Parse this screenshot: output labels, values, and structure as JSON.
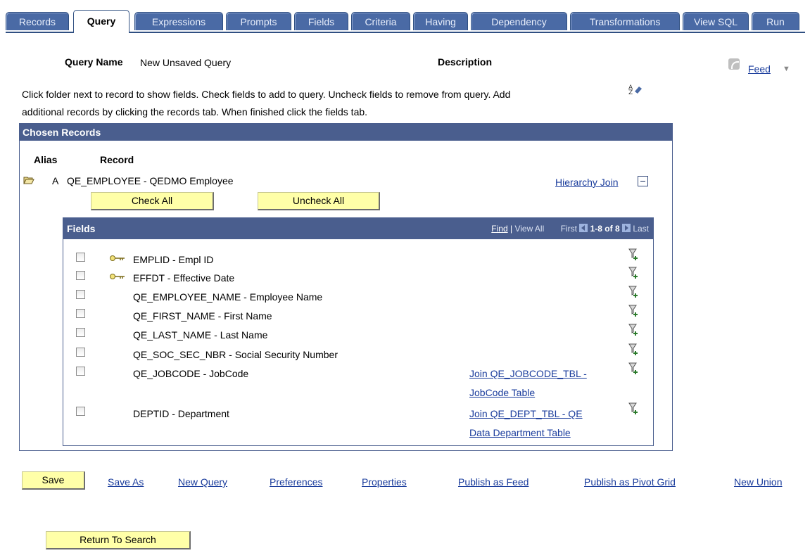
{
  "tabs": [
    "Records",
    "Query",
    "Expressions",
    "Prompts",
    "Fields",
    "Criteria",
    "Having",
    "Dependency",
    "Transformations",
    "View SQL",
    "Run"
  ],
  "header": {
    "query_name_label": "Query Name",
    "query_name_value": "New Unsaved Query",
    "description_label": "Description",
    "feed_label": "Feed",
    "instructions_line1": "Click folder next to record to show fields. Check fields to add to query. Uncheck fields to remove from query. Add",
    "instructions_line2": "additional records by clicking the records tab. When finished click the fields tab."
  },
  "chosen_records": {
    "title": "Chosen Records",
    "alias_header": "Alias",
    "record_header": "Record",
    "alias": "A",
    "record": "QE_EMPLOYEE - QEDMO Employee",
    "hierarchy_join": "Hierarchy Join",
    "check_all": "Check All",
    "uncheck_all": "Uncheck All"
  },
  "fields_grid": {
    "title": "Fields",
    "find": "Find",
    "view_all": "View All",
    "first": "First",
    "range": "1-8 of 8",
    "last": "Last",
    "rows": [
      {
        "label": "EMPLID - Empl ID",
        "key": true,
        "join1": "",
        "join2": ""
      },
      {
        "label": "EFFDT - Effective Date",
        "key": true,
        "join1": "",
        "join2": ""
      },
      {
        "label": "QE_EMPLOYEE_NAME - Employee Name",
        "key": false,
        "join1": "",
        "join2": ""
      },
      {
        "label": "QE_FIRST_NAME - First Name",
        "key": false,
        "join1": "",
        "join2": ""
      },
      {
        "label": "QE_LAST_NAME - Last Name",
        "key": false,
        "join1": "",
        "join2": ""
      },
      {
        "label": "QE_SOC_SEC_NBR - Social Security Number",
        "key": false,
        "join1": "",
        "join2": ""
      },
      {
        "label": "QE_JOBCODE - JobCode",
        "key": false,
        "join1": "Join QE_JOBCODE_TBL -",
        "join2": "JobCode Table"
      },
      {
        "label": "DEPTID - Department",
        "key": false,
        "join1": "Join QE_DEPT_TBL - QE",
        "join2": "Data Department Table"
      }
    ]
  },
  "footer": {
    "save": "Save",
    "links": [
      "Save As",
      "New Query",
      "Preferences",
      "Properties",
      "Publish as Feed",
      "Publish as Pivot Grid",
      "New Union"
    ],
    "return_to_search": "Return To Search"
  }
}
